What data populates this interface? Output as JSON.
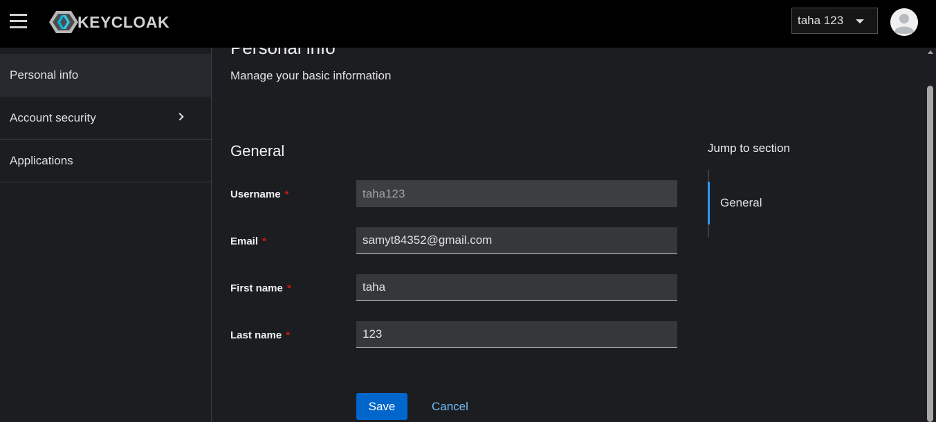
{
  "header": {
    "logo_text": "KEYCLOAK",
    "menu_icon": "hamburger-menu-icon",
    "user_dropdown": {
      "label": "taha 123",
      "icon": "caret-down-icon"
    },
    "avatar_icon": "user-avatar-icon"
  },
  "sidebar": {
    "items": [
      {
        "label": "Personal info",
        "active": true
      },
      {
        "label": "Account security",
        "icon": "chevron-right-icon"
      },
      {
        "label": "Applications"
      }
    ]
  },
  "main": {
    "title": "Personal info",
    "subtitle": "Manage your basic information",
    "section_title": "General",
    "required_mark": "*",
    "fields": [
      {
        "label": "Username",
        "value": "taha123",
        "readonly": true
      },
      {
        "label": "Email",
        "value": "samyt84352@gmail.com"
      },
      {
        "label": "First name",
        "value": "taha"
      },
      {
        "label": "Last name",
        "value": "123"
      }
    ],
    "save_label": "Save",
    "cancel_label": "Cancel"
  },
  "jump": {
    "title": "Jump to section",
    "items": [
      {
        "label": "General"
      }
    ]
  },
  "colors": {
    "accent": "#0066cc",
    "link": "#73bcf7",
    "active_indicator": "#2b9af3",
    "required": "#c9190b",
    "header_bg": "#000000",
    "page_bg": "#1b1d21"
  }
}
